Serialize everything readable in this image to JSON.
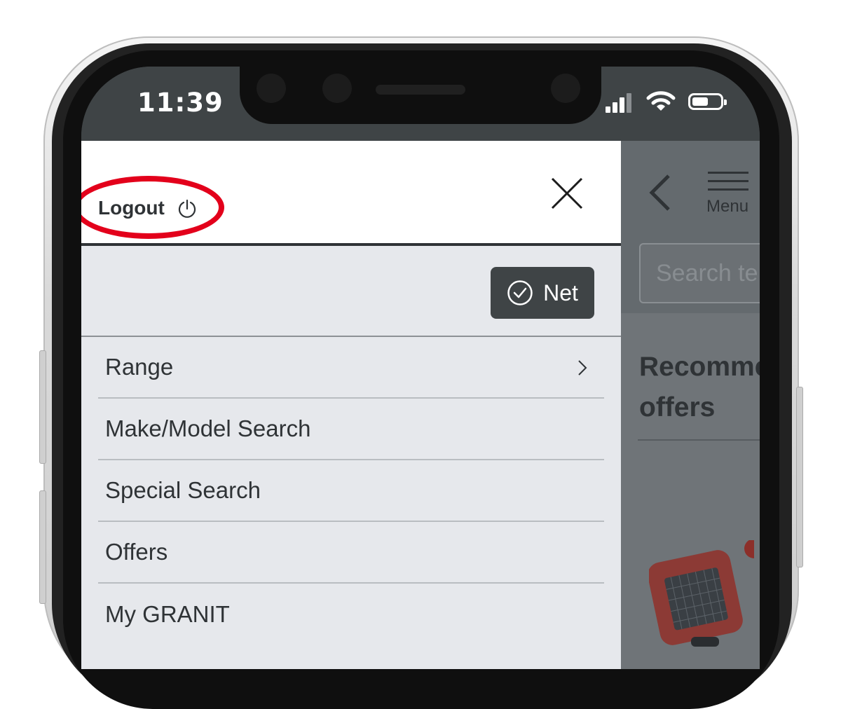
{
  "status_bar": {
    "time": "11:39",
    "icons": [
      "signal-icon",
      "wifi-icon",
      "battery-icon"
    ]
  },
  "drawer": {
    "logout_label": "Logout",
    "logout_icon": "power-icon",
    "close_icon": "close-icon",
    "net_label": "Net",
    "net_icon": "checkmark-circle-icon",
    "menu_items": [
      {
        "label": "Range",
        "has_chevron": true
      },
      {
        "label": "Make/Model Search",
        "has_chevron": false
      },
      {
        "label": "Special Search",
        "has_chevron": false
      },
      {
        "label": "Offers",
        "has_chevron": false
      },
      {
        "label": "My GRANIT",
        "has_chevron": false
      }
    ]
  },
  "background_page": {
    "back_icon": "chevron-left-icon",
    "menu_label": "Menu",
    "search_placeholder": "Search te",
    "section_title": "Recomme\noffers"
  },
  "colors": {
    "accent_highlight": "#e3001b",
    "dark": "#3f4446",
    "drawer_bg": "#e6e8ec"
  }
}
